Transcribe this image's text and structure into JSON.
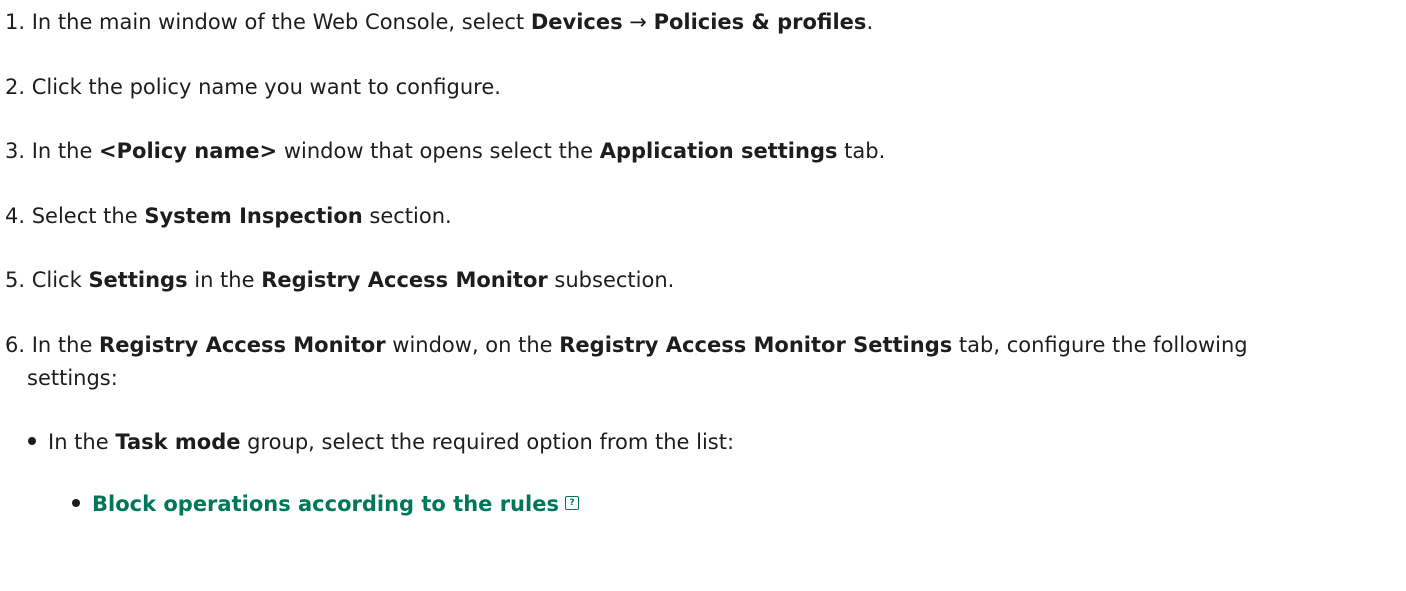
{
  "steps": [
    {
      "num": "1.",
      "t1": " In the main window of the Web Console, select ",
      "b1": "Devices",
      "t2": " → ",
      "b2": "Policies & profiles",
      "t3": "."
    },
    {
      "num": "2.",
      "t1": " Click the policy name you want to configure."
    },
    {
      "num": "3.",
      "t1": " In the ",
      "b1": "<Policy name>",
      "t2": " window that opens select the ",
      "b2": "Application settings",
      "t3": " tab."
    },
    {
      "num": "4.",
      "t1": " Select the ",
      "b1": "System Inspection",
      "t2": " section."
    },
    {
      "num": "5.",
      "t1": " Click ",
      "b1": "Settings",
      "t2": " in the ",
      "b2": "Registry Access Monitor",
      "t3": " subsection."
    },
    {
      "num": "6.",
      "t1": " In the ",
      "b1": "Registry Access Monitor",
      "t2": " window, on the ",
      "b2": "Registry Access Monitor Settings",
      "t3": " tab, configure the following",
      "line2": "settings:"
    }
  ],
  "bullet1": {
    "t1": "In the ",
    "b1": "Task mode",
    "t2": " group, select the required option from the list:"
  },
  "bullet2": {
    "link": "Block operations according to the rules",
    "icon": "help-icon",
    "icon_glyph": "?"
  },
  "colors": {
    "text": "#1d1d1b",
    "link": "#00775a"
  }
}
